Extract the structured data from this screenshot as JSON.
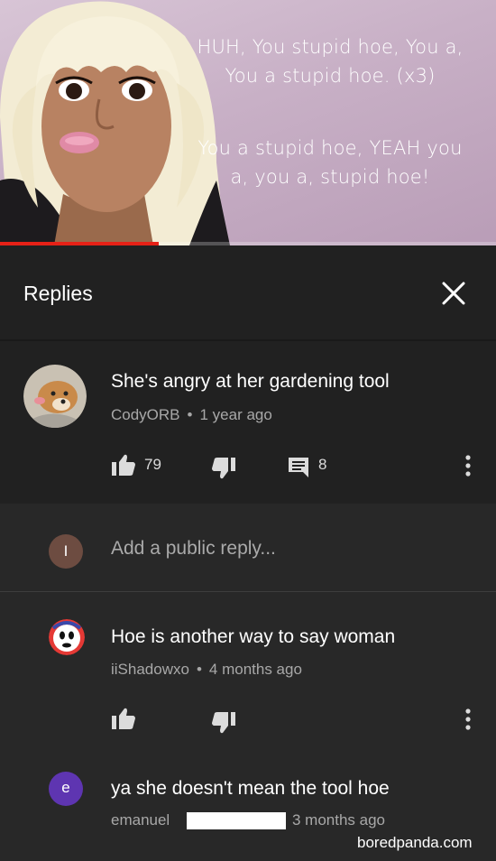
{
  "video": {
    "lyrics_line1a": "HUH, You stupid hoe, You a,",
    "lyrics_line1b": "You a stupid hoe. (x3)",
    "lyrics_line2a": "You a stupid hoe, YEAH you",
    "lyrics_line2b": "a, you a, stupid hoe!",
    "progress": 0.32
  },
  "panel": {
    "title": "Replies",
    "close_icon": "close-icon"
  },
  "parent_comment": {
    "text": "She's angry at her gardening tool",
    "author": "CodyORB",
    "dot": "•",
    "time": "1 year ago",
    "likes": "79",
    "replies": "8"
  },
  "reply_box": {
    "avatar_letter": "I",
    "placeholder": "Add a public reply..."
  },
  "replies": [
    {
      "text": "Hoe is another way to say woman",
      "author": "iiShadowxo",
      "dot": "•",
      "time": "4 months ago"
    },
    {
      "avatar_letter": "e",
      "text": "ya she doesn't mean the tool hoe",
      "author": "emanuel",
      "time": "3 months ago"
    }
  ],
  "watermark": "boredpanda.com",
  "colors": {
    "background": "#282828",
    "panel": "#212121",
    "accent_red": "#e62117",
    "meta_gray": "#a8a8a8"
  }
}
